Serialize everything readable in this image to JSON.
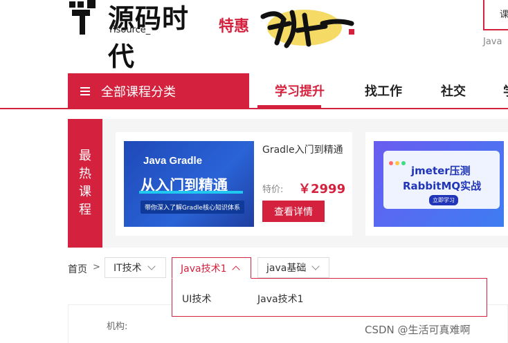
{
  "header": {
    "logo_cn": "源码时代",
    "logo_en": "ITsource_",
    "promo_text": "特惠",
    "search_label": "课",
    "hot_word": "Java"
  },
  "nav": {
    "all_categories": "全部课程分类",
    "items": [
      "学习提升",
      "找工作",
      "社交",
      "学"
    ],
    "active_index": 0
  },
  "hot": {
    "label_chars": [
      "最",
      "热",
      "课",
      "程"
    ],
    "cards": [
      {
        "thumb_title": "Java Gradle",
        "thumb_subtitle": "从入门到精通",
        "thumb_tag": "带你深入了解Gradle核心知识体系",
        "title": "Gradle入门到精通",
        "price_label": "特价:",
        "price": "￥2999",
        "button": "查看详情"
      },
      {
        "thumb_title": "jmeter压测",
        "thumb_subtitle": "RabbitMQ实战",
        "thumb_tag": "立即学习"
      }
    ]
  },
  "breadcrumb": {
    "home": "首页",
    "arrow": ">",
    "items": [
      "IT技术",
      "Java技术1",
      "java基础"
    ],
    "open_index": 1
  },
  "dropdown": {
    "options": [
      "UI技术",
      "Java技术1"
    ]
  },
  "filter": {
    "label": "机构:"
  },
  "watermark": "CSDN @生活可真难啊",
  "colors": {
    "accent": "#d4213d",
    "panel_bg": "#f5f5f5"
  }
}
